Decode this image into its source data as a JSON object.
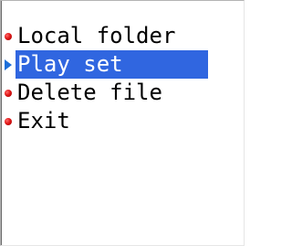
{
  "menu": {
    "items": [
      {
        "label": "Local folder",
        "marker": "red-dot-icon",
        "selected": false
      },
      {
        "label": "Play set",
        "marker": "blue-arrow-icon",
        "selected": true
      },
      {
        "label": "Delete file",
        "marker": "red-dot-icon",
        "selected": false
      },
      {
        "label": "Exit",
        "marker": "red-dot-icon",
        "selected": false
      }
    ]
  },
  "colors": {
    "selection_bg": "#3066e0",
    "selection_text": "#ffffff",
    "dot": "#e01818",
    "arrow": "#1e6fd9"
  }
}
